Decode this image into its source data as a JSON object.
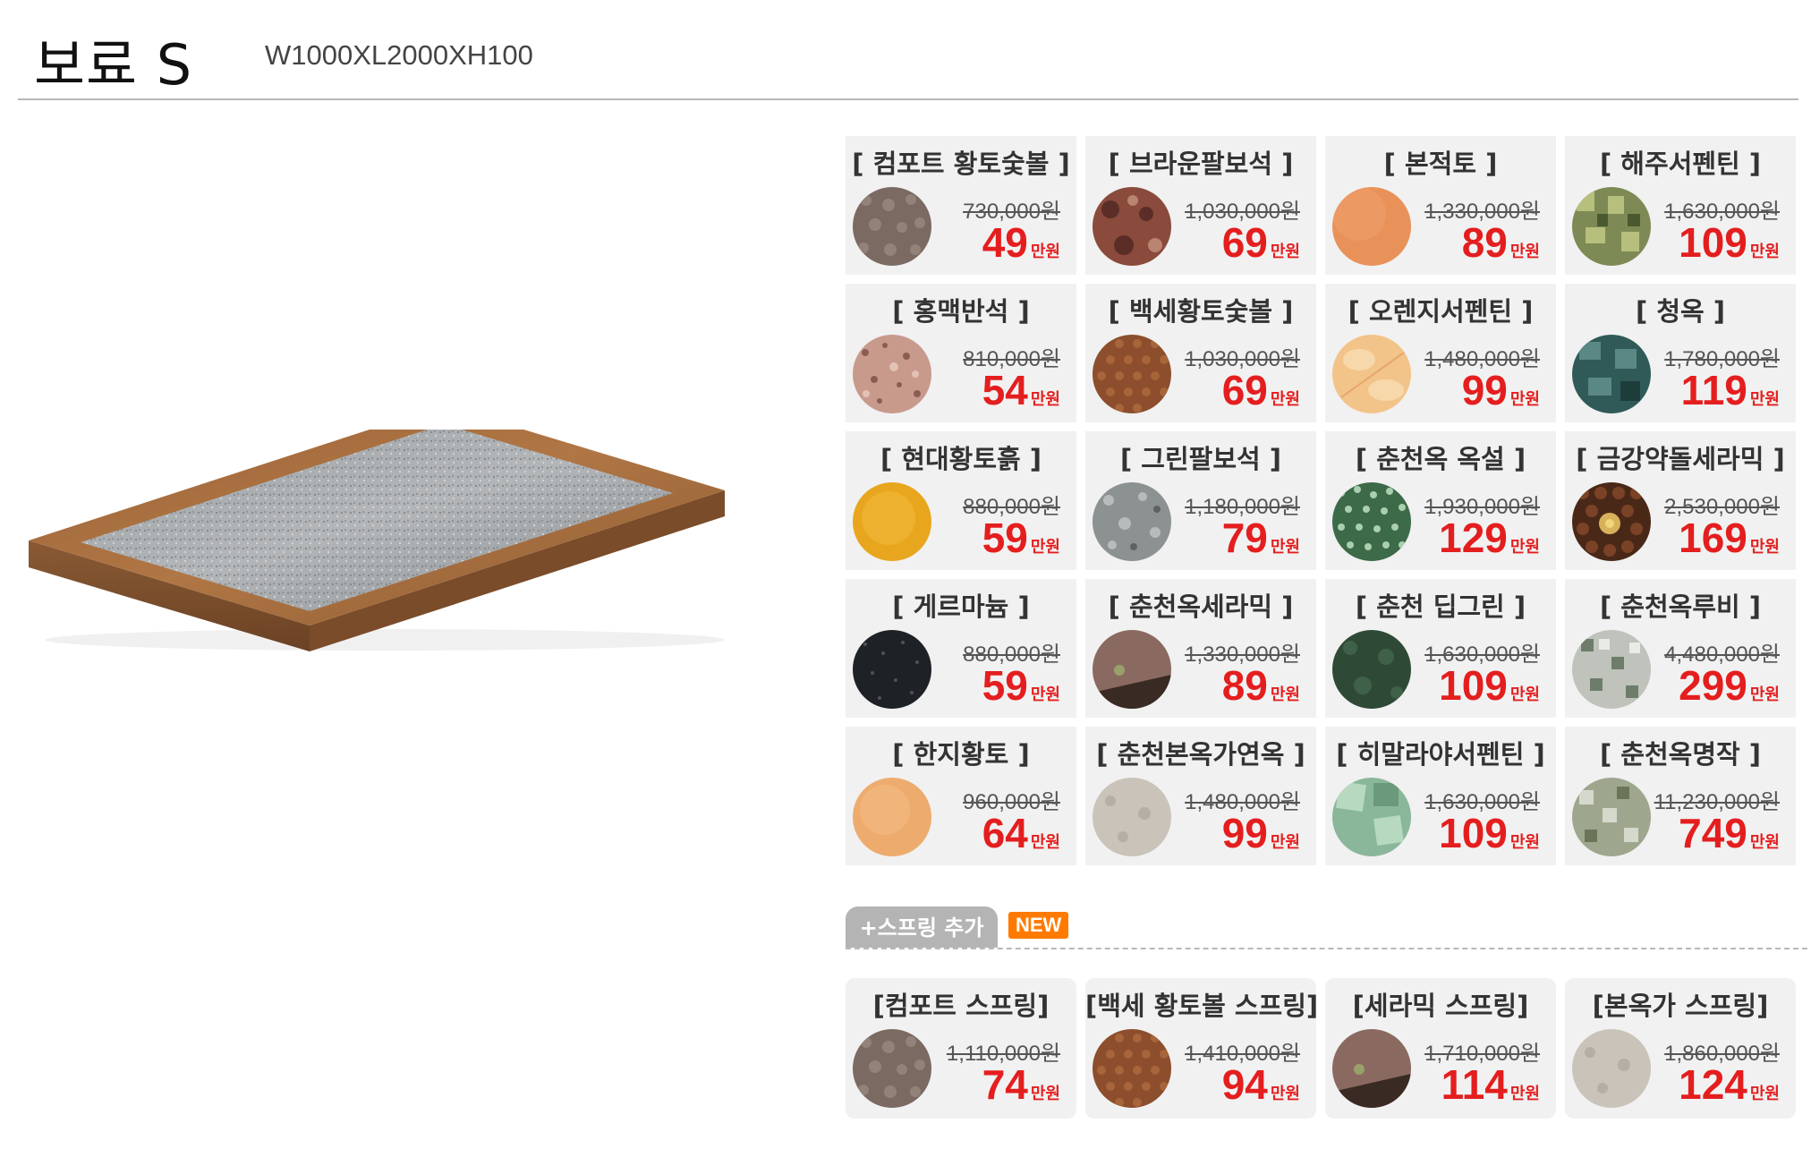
{
  "header": {
    "title": "보료 S",
    "dimensions": "W1000XL2000XH100"
  },
  "price_unit": "만원",
  "colors": {
    "sale": "#e41e1e",
    "new_badge": "#ff7a00",
    "card_bg": "#f1f1f1"
  },
  "materials": [
    {
      "name": "[ 컴포트 황토숯볼 ]",
      "orig": "730,000원",
      "sale": "49",
      "swatch": "brown-pebble"
    },
    {
      "name": "[ 브라운팔보석 ]",
      "orig": "1,030,000원",
      "sale": "69",
      "swatch": "red-granite"
    },
    {
      "name": "[ 본적토 ]",
      "orig": "1,330,000원",
      "sale": "89",
      "swatch": "orange-clay"
    },
    {
      "name": "[ 해주서펜틴 ]",
      "orig": "1,630,000원",
      "sale": "109",
      "swatch": "green-mosaic"
    },
    {
      "name": "[ 홍맥반석 ]",
      "orig": "810,000원",
      "sale": "54",
      "swatch": "pink-granite"
    },
    {
      "name": "[ 백세황토숯볼 ]",
      "orig": "1,030,000원",
      "sale": "69",
      "swatch": "brown-beads"
    },
    {
      "name": "[ 오렌지서펜틴 ]",
      "orig": "1,480,000원",
      "sale": "99",
      "swatch": "light-orange"
    },
    {
      "name": "[ 청옥 ]",
      "orig": "1,780,000원",
      "sale": "119",
      "swatch": "teal-jade"
    },
    {
      "name": "[ 현대황토흙 ]",
      "orig": "880,000원",
      "sale": "59",
      "swatch": "yellow-clay"
    },
    {
      "name": "[ 그린팔보석 ]",
      "orig": "1,180,000원",
      "sale": "79",
      "swatch": "gray-granite"
    },
    {
      "name": "[ 춘천옥 옥설 ]",
      "orig": "1,930,000원",
      "sale": "129",
      "swatch": "green-speckle"
    },
    {
      "name": "[ 금강약돌세라믹 ]",
      "orig": "2,530,000원",
      "sale": "169",
      "swatch": "ceramic-beads"
    },
    {
      "name": "[ 게르마늄 ]",
      "orig": "880,000원",
      "sale": "59",
      "swatch": "black-stone"
    },
    {
      "name": "[ 춘천옥세라믹 ]",
      "orig": "1,330,000원",
      "sale": "89",
      "swatch": "mauve-ceramic"
    },
    {
      "name": "[ 춘천 딥그린 ]",
      "orig": "1,630,000원",
      "sale": "109",
      "swatch": "deep-green"
    },
    {
      "name": "[ 춘천옥루비 ]",
      "orig": "4,480,000원",
      "sale": "299",
      "swatch": "gray-mosaic"
    },
    {
      "name": "[ 한지황토 ]",
      "orig": "960,000원",
      "sale": "64",
      "swatch": "peach-clay"
    },
    {
      "name": "[ 춘천본옥가연옥 ]",
      "orig": "1,480,000원",
      "sale": "99",
      "swatch": "beige-stone"
    },
    {
      "name": "[ 히말라야서펜틴 ]",
      "orig": "1,630,000원",
      "sale": "109",
      "swatch": "light-green-tile"
    },
    {
      "name": "[ 춘천옥명작 ]",
      "orig": "11,230,000원",
      "sale": "749",
      "swatch": "sage-mosaic"
    }
  ],
  "addon": {
    "tab_label": "+스프링 추가",
    "badge": "NEW"
  },
  "springs": [
    {
      "name": "[컴포트 스프링]",
      "orig": "1,110,000원",
      "sale": "74",
      "swatch": "brown-pebble"
    },
    {
      "name": "[백세 황토볼 스프링]",
      "orig": "1,410,000원",
      "sale": "94",
      "swatch": "brown-beads"
    },
    {
      "name": "[세라믹 스프링]",
      "orig": "1,710,000원",
      "sale": "114",
      "swatch": "mauve-ceramic"
    },
    {
      "name": "[본옥가 스프링]",
      "orig": "1,860,000원",
      "sale": "124",
      "swatch": "beige-stone"
    }
  ]
}
